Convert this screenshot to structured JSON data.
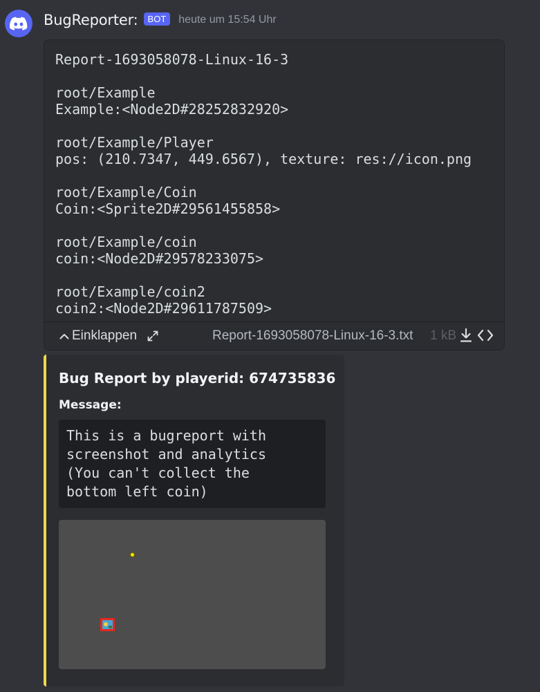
{
  "message": {
    "author": "BugReporter:",
    "bot_tag": "BOT",
    "timestamp": "heute um 15:54 Uhr"
  },
  "attachment": {
    "content": "Report-1693058078-Linux-16-3\n\nroot/Example\nExample:<Node2D#28252832920>\n\nroot/Example/Player\npos: (210.7347, 449.6567), texture: res://icon.png\n\nroot/Example/Coin\nCoin:<Sprite2D#29561455858>\n\nroot/Example/coin\ncoin:<Node2D#29578233075>\n\nroot/Example/coin2\ncoin2:<Node2D#29611787509>",
    "collapse_label": "Einklappen",
    "file_name": "Report-1693058078-Linux-16-3.txt",
    "file_size": "1 kB"
  },
  "embed": {
    "accent_color": "#f0d84a",
    "title": "Bug Report by playerid: 674735836",
    "field_name": "Message:",
    "field_value": "This is a bugreport with\nscreenshot and analytics\n(You can't collect the\nbottom left coin)"
  },
  "icons": {
    "avatar": "discord-logo-icon",
    "collapse": "chevron-up-icon",
    "expand": "expand-arrows-icon",
    "download": "download-icon",
    "code": "code-icon"
  }
}
